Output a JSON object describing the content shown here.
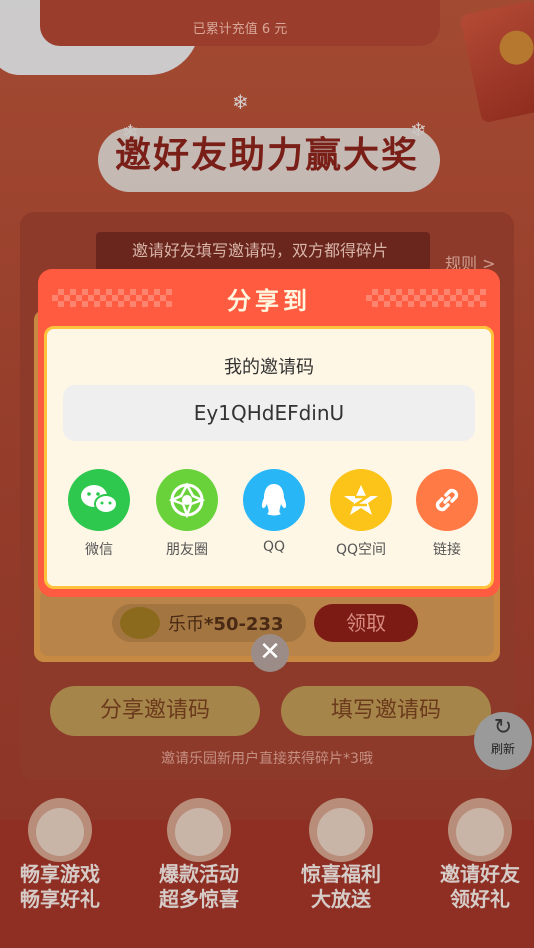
{
  "header": {
    "recharge_text": "已累计充值 6 元"
  },
  "main": {
    "title": "邀好友助力赢大奖",
    "banner_text": "邀请好友填写邀请码，双方都得碎片",
    "rules_link": "规则 >",
    "reward": {
      "currency": "乐币",
      "amount": "*50-233",
      "claim_label": "领取"
    },
    "share_code_button": "分享邀请码",
    "fill_code_button": "填写邀请码",
    "hint": "邀请乐园新用户直接获得碎片*3哦"
  },
  "refresh": {
    "label": "刷新",
    "icon": "refresh-icon"
  },
  "promos": [
    {
      "line1": "畅享游戏",
      "line2": "畅享好礼"
    },
    {
      "line1": "爆款活动",
      "line2": "超多惊喜"
    },
    {
      "line1": "惊喜福利",
      "line2": "大放送"
    },
    {
      "line1": "邀请好友",
      "line2": "领好礼"
    }
  ],
  "modal": {
    "title": "分享到",
    "code_label": "我的邀请码",
    "invite_code": "Ey1QHdEFdinU",
    "share_targets": [
      {
        "label": "微信",
        "icon": "wechat-icon",
        "color": "#2dc84d"
      },
      {
        "label": "朋友圈",
        "icon": "moments-icon",
        "color": "#69d23b"
      },
      {
        "label": "QQ",
        "icon": "qq-icon",
        "color": "#29b6f6"
      },
      {
        "label": "QQ空间",
        "icon": "qzone-icon",
        "color": "#fcc419"
      },
      {
        "label": "链接",
        "icon": "link-icon",
        "color": "#ff7a45"
      }
    ],
    "close_icon": "close-icon"
  }
}
